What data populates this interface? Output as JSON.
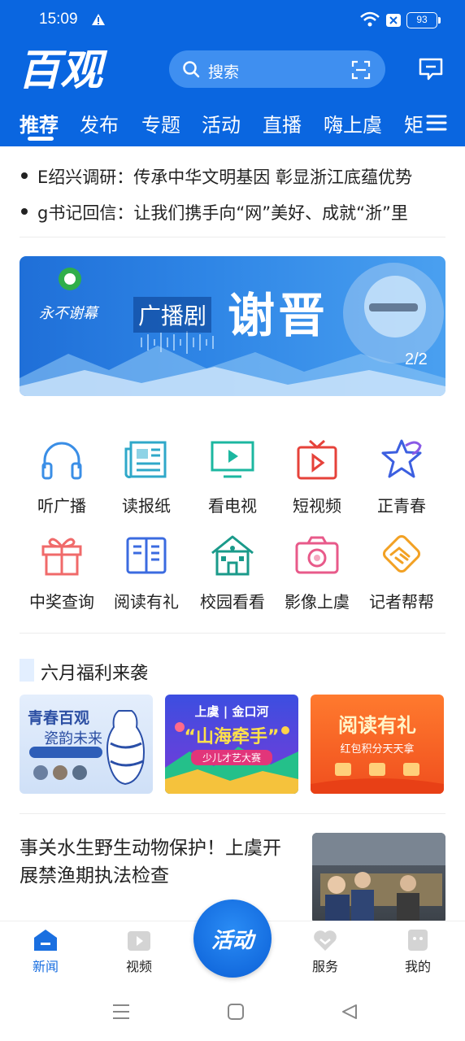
{
  "status_bar": {
    "time": "15:09",
    "battery": "93"
  },
  "header": {
    "logo_text": "百观",
    "search_placeholder": "搜索",
    "tabs": [
      "推荐",
      "发布",
      "专题",
      "活动",
      "直播",
      "嗨上虞",
      "矩"
    ]
  },
  "ticker": [
    "E绍兴调研：传承中华文明基因 彰显浙江底蕴优势",
    "g书记回信：让我们携手向“网”美好、成就“浙”里"
  ],
  "banner": {
    "title": "广播剧",
    "big_text": "谢晋",
    "counter": "2/2",
    "logo_caption": "永不谢幕"
  },
  "grid": [
    {
      "label": "听广播",
      "icon": "headphones-icon",
      "color": "#3a8ee6"
    },
    {
      "label": "读报纸",
      "icon": "newspaper-icon",
      "color": "#2fa8c9"
    },
    {
      "label": "看电视",
      "icon": "tv-icon",
      "color": "#1cb7a0"
    },
    {
      "label": "短视频",
      "icon": "short-video-icon",
      "color": "#e6423a"
    },
    {
      "label": "正青春",
      "icon": "youth-star-icon",
      "color": "#3c5fe0"
    },
    {
      "label": "中奖查询",
      "icon": "gift-icon",
      "color": "#f06a6a"
    },
    {
      "label": "阅读有礼",
      "icon": "book-icon",
      "color": "#3b6be0"
    },
    {
      "label": "校园看看",
      "icon": "school-icon",
      "color": "#1a9a8a"
    },
    {
      "label": "影像上虞",
      "icon": "camera-icon",
      "color": "#e85a8a"
    },
    {
      "label": "记者帮帮",
      "icon": "handshake-icon",
      "color": "#f2a124"
    }
  ],
  "section": {
    "title": "六月福利来袭"
  },
  "promos": [
    {
      "line1": "青春百观",
      "line2": "瓷韵未来"
    },
    {
      "line1": "上虞 | 金口河",
      "line2": "“山海牵手”",
      "line3": "少儿才艺大赛"
    },
    {
      "line1": "阅读有礼",
      "line2": "红包积分天天拿"
    }
  ],
  "news": {
    "title": "事关水生野生动物保护！上虞开展禁渔期执法检查"
  },
  "bottom_nav": {
    "items": [
      "新闻",
      "视频",
      "服务",
      "我的"
    ],
    "center": "活动"
  },
  "colors": {
    "primary": "#0a66e0",
    "active_nav": "#1a6fe0"
  }
}
